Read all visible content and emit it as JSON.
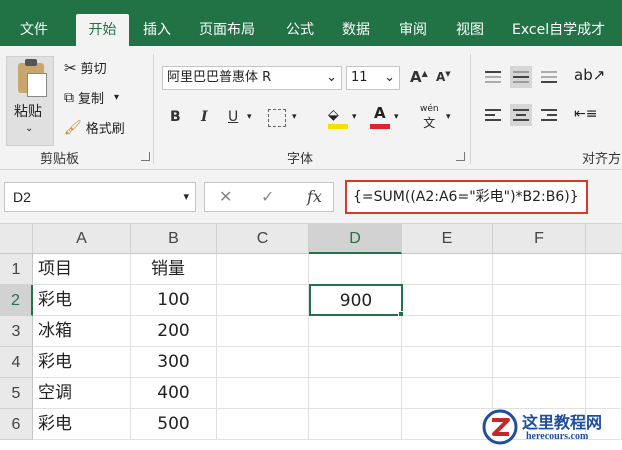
{
  "tabs": [
    "文件",
    "开始",
    "插入",
    "页面布局",
    "公式",
    "数据",
    "审阅",
    "视图",
    "Excel自学成才"
  ],
  "active_tab": "开始",
  "clipboard": {
    "paste": "粘贴",
    "cut": "剪切",
    "copy": "复制",
    "format_painter": "格式刷",
    "group": "剪贴板"
  },
  "font": {
    "name": "阿里巴巴普惠体 R",
    "size": "11",
    "grow": "A",
    "shrink": "A",
    "bold": "B",
    "italic": "I",
    "underline": "U",
    "group": "字体",
    "phonetic": "wén"
  },
  "alignment": {
    "group": "对齐方"
  },
  "formula_bar": {
    "name_box": "D2",
    "cancel": "✕",
    "enter": "✓",
    "fx": "fx",
    "formula": "{=SUM((A2:A6=\"彩电\")*B2:B6)}"
  },
  "columns": [
    "A",
    "B",
    "C",
    "D",
    "E",
    "F"
  ],
  "rows": [
    "1",
    "2",
    "3",
    "4",
    "5",
    "6"
  ],
  "cells": {
    "A1": "项目",
    "B1": "销量",
    "A2": "彩电",
    "B2": "100",
    "D2": "900",
    "A3": "冰箱",
    "B3": "200",
    "A4": "彩电",
    "B4": "300",
    "A5": "空调",
    "B5": "400",
    "A6": "彩电",
    "B6": "500"
  },
  "watermark": {
    "title": "这里教程网",
    "url": "herecours.com"
  },
  "colors": {
    "ribbon_green": "#217346",
    "highlight_red": "#d9382c",
    "font_color_bar": "#e0242a",
    "fill_color_bar": "#f5e000"
  }
}
